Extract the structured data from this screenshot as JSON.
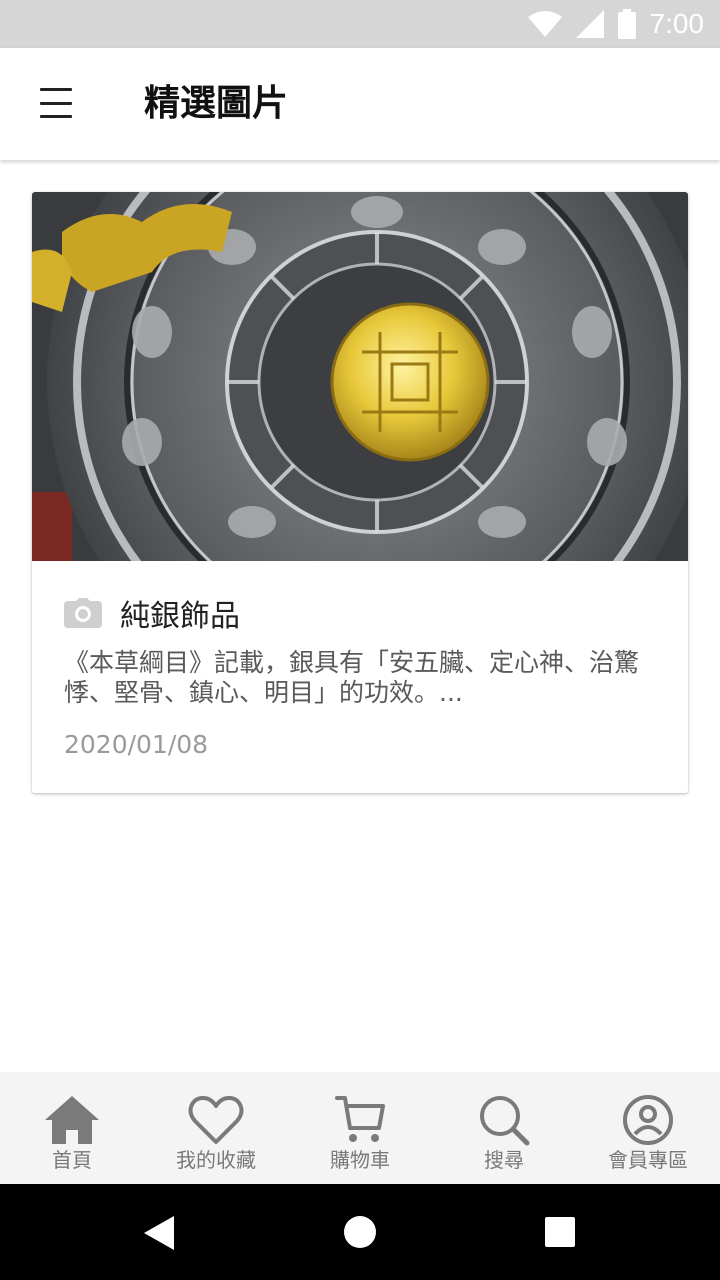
{
  "status_bar": {
    "time": "7:00",
    "icons": [
      "wifi-icon",
      "signal-icon",
      "battery-icon"
    ]
  },
  "app_bar": {
    "title": "精選圖片",
    "menu_icon": "hamburger-menu-icon"
  },
  "card": {
    "image_description": "silver-and-gold-amulet-photo",
    "title_icon": "camera-icon",
    "title": "純銀飾品",
    "description": "《本草綱目》記載，銀具有「安五臟、定心神、治驚悸、堅骨、鎮心、明目」的功效。...",
    "date": "2020/01/08"
  },
  "bottom_nav": {
    "items": [
      {
        "label": "首頁",
        "icon": "home-icon"
      },
      {
        "label": "我的收藏",
        "icon": "heart-icon"
      },
      {
        "label": "購物車",
        "icon": "cart-icon"
      },
      {
        "label": "搜尋",
        "icon": "search-icon"
      },
      {
        "label": "會員專區",
        "icon": "account-icon"
      }
    ]
  },
  "system_nav": {
    "buttons": [
      "back",
      "home",
      "recents"
    ]
  },
  "colors": {
    "status_bar": "#d6d6d6",
    "bottom_nav_bg": "#f4f4f4",
    "nav_icon": "#7a7a7a",
    "title_text": "#111111",
    "desc_text": "#5a5a5a",
    "date_text": "#9a9a9a"
  }
}
